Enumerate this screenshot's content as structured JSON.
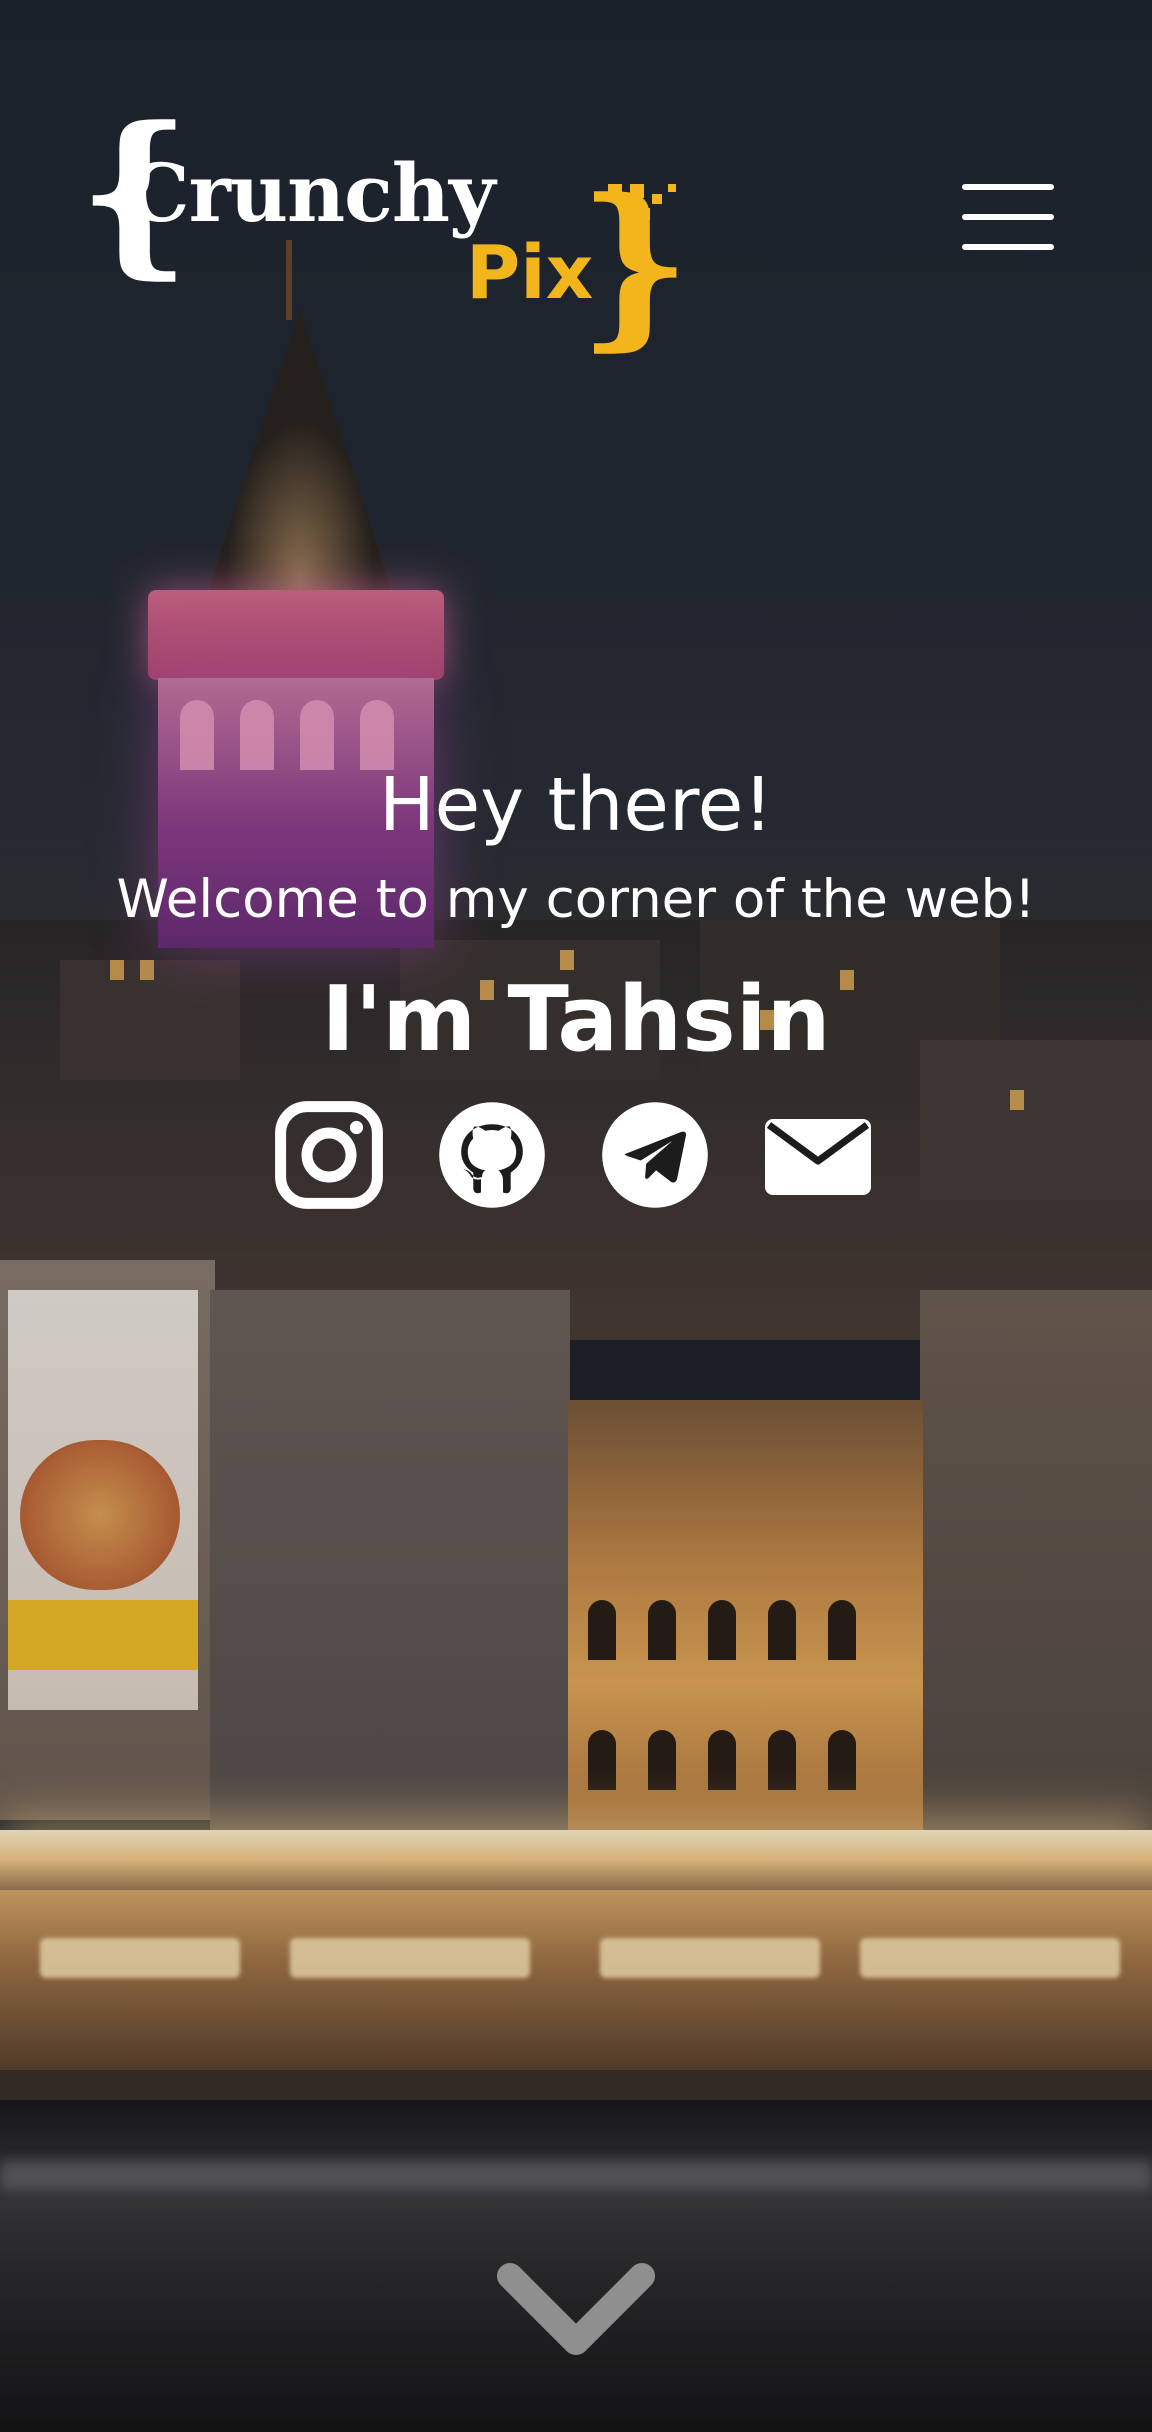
{
  "brand": {
    "left_brace": "{",
    "name_part1": "Crunchy",
    "name_part2": "Pix",
    "right_brace": "}",
    "colors": {
      "primary": "#ffffff",
      "accent": "#f2b51c"
    }
  },
  "header": {
    "menu_icon": "hamburger-icon"
  },
  "hero": {
    "greeting": "Hey there!",
    "welcome": "Welcome to my corner of the web!",
    "name": "I'm Tahsin"
  },
  "social_links": [
    {
      "id": "instagram",
      "icon": "instagram-icon"
    },
    {
      "id": "github",
      "icon": "github-icon"
    },
    {
      "id": "telegram",
      "icon": "telegram-icon"
    },
    {
      "id": "email",
      "icon": "mail-icon"
    }
  ],
  "scroll_indicator": {
    "icon": "chevron-down-icon"
  },
  "background": {
    "description_icon": "city-night-background"
  }
}
